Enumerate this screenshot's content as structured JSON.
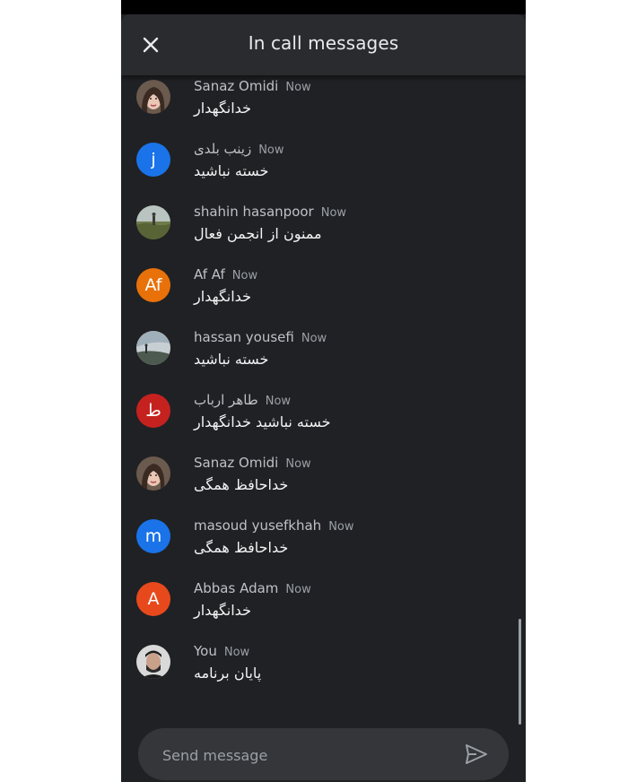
{
  "header": {
    "title": "In call messages",
    "close_icon": "close-icon"
  },
  "colors": {
    "background": "#202124",
    "header": "#2a2b2e",
    "blue_avatar": "#1a73e8",
    "orange_avatar": "#e8710a",
    "red_avatar": "#c5221f",
    "redorange_avatar": "#e8491c"
  },
  "messages": [
    {
      "name": "Sanaz Omidi",
      "time": "Now",
      "text": "خدانگهدار",
      "avatar_type": "photo-woman"
    },
    {
      "name": "زینب بلدی",
      "time": "Now",
      "text": "خسته نباشید",
      "avatar_letter": "j",
      "avatar_color": "#1a73e8"
    },
    {
      "name": "shahin hasanpoor",
      "time": "Now",
      "text": "ممنون از انجمن فعال",
      "avatar_type": "photo-landscape"
    },
    {
      "name": "Af Af",
      "time": "Now",
      "text": "خدانگهدار",
      "avatar_letter": "Af",
      "avatar_color": "#e8710a"
    },
    {
      "name": "hassan yousefi",
      "time": "Now",
      "text": "خسته نباشید",
      "avatar_type": "photo-sky"
    },
    {
      "name": "طاهر ارباب",
      "time": "Now",
      "text": "خسته نباشید خدانگهدار",
      "avatar_letter": "ط",
      "avatar_color": "#c5221f"
    },
    {
      "name": "Sanaz Omidi",
      "time": "Now",
      "text": "خداحافظ همگی",
      "avatar_type": "photo-woman"
    },
    {
      "name": "masoud yusefkhah",
      "time": "Now",
      "text": "خداحافظ همگی",
      "avatar_letter": "m",
      "avatar_color": "#1a73e8"
    },
    {
      "name": "Abbas Adam",
      "time": "Now",
      "text": "خدانگهدار",
      "avatar_letter": "A",
      "avatar_color": "#e8491c"
    },
    {
      "name": "You",
      "time": "Now",
      "text": "پایان برنامه",
      "avatar_type": "photo-man"
    }
  ],
  "composer": {
    "placeholder": "Send message",
    "send_icon": "send-icon"
  }
}
